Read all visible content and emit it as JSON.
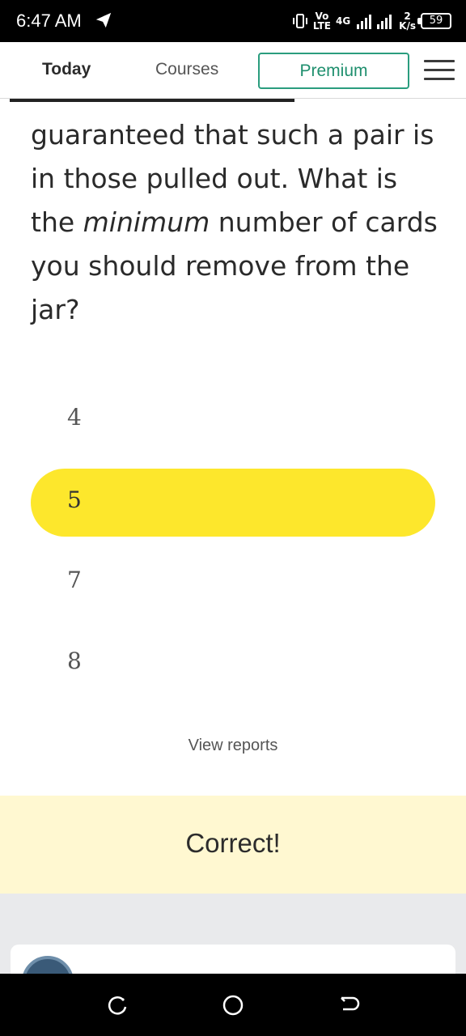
{
  "status_bar": {
    "time": "6:47 AM",
    "network_top": "Vo",
    "network_bottom": "LTE",
    "net_type": "4G",
    "speed_value": "2",
    "speed_unit": "K/s",
    "battery": "59"
  },
  "header": {
    "tabs": [
      {
        "label": "Today"
      },
      {
        "label": "Courses"
      }
    ],
    "premium_label": "Premium"
  },
  "question": {
    "part1": "guaranteed that such a pair is in those pulled out. What is the ",
    "emphasis": "minimum",
    "part2": " number of cards you should remove from the jar?"
  },
  "options": [
    {
      "label": "4",
      "selected": false
    },
    {
      "label": "5",
      "selected": true
    },
    {
      "label": "7",
      "selected": false
    },
    {
      "label": "8",
      "selected": false
    }
  ],
  "view_reports": "View reports",
  "feedback": "Correct!",
  "colors": {
    "accent": "#2a9d7e",
    "selected_option": "#fde72c",
    "feedback_bg": "#fff8d1"
  },
  "icons": [
    "telegram-plane-icon",
    "vibrate-icon",
    "signal-icon",
    "battery-icon",
    "menu-icon",
    "back-icon",
    "home-icon",
    "recents-icon"
  ]
}
